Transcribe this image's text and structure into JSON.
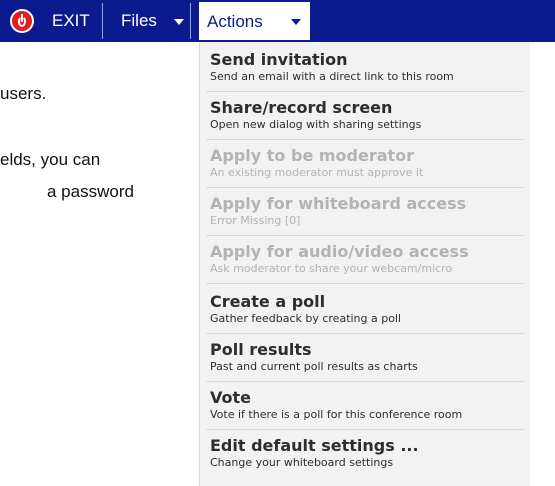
{
  "toolbar": {
    "exit_label": "EXIT",
    "files_label": "Files",
    "actions_label": "Actions"
  },
  "background_text": {
    "line1": "users.",
    "line2": "elds,   you   can",
    "line3": "a   password"
  },
  "actions_menu": {
    "items": [
      {
        "title": "Send invitation",
        "desc": "Send an email with a direct link to this room",
        "enabled": true
      },
      {
        "title": "Share/record screen",
        "desc": "Open new dialog with sharing settings",
        "enabled": true
      },
      {
        "title": "Apply to be moderator",
        "desc": "An existing moderator must approve it",
        "enabled": false
      },
      {
        "title": "Apply for whiteboard access",
        "desc": "Error Missing [0]",
        "enabled": false
      },
      {
        "title": "Apply for audio/video access",
        "desc": "Ask moderator to share your webcam/micro",
        "enabled": false
      },
      {
        "title": "Create a poll",
        "desc": "Gather feedback by creating a poll",
        "enabled": true
      },
      {
        "title": "Poll results",
        "desc": "Past and current poll results as charts",
        "enabled": true
      },
      {
        "title": "Vote",
        "desc": "Vote if there is a poll for this conference room",
        "enabled": true
      },
      {
        "title": "Edit default settings ...",
        "desc": "Change your whiteboard settings",
        "enabled": true
      }
    ]
  },
  "colors": {
    "toolbar_bg": "#0b1a8c",
    "exit_icon": "#e02020",
    "menu_bg": "#f2f2f2",
    "disabled_text": "#b3b3b3"
  }
}
